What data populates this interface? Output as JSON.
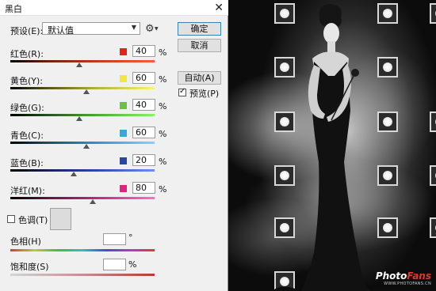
{
  "dialog": {
    "title": "黑白",
    "preset": {
      "label": "预设(E):",
      "value": "默认值"
    },
    "buttons": {
      "ok": "确定",
      "cancel": "取消",
      "auto": "自动(A)"
    },
    "preview": {
      "label": "预览(P)",
      "checked": true
    },
    "channels": [
      {
        "label": "红色(R):",
        "value": "40",
        "unit": "%",
        "color": "#e8211b",
        "slider_percent": 48
      },
      {
        "label": "黄色(Y):",
        "value": "60",
        "unit": "%",
        "color": "#f3e73a",
        "slider_percent": 53
      },
      {
        "label": "绿色(G):",
        "value": "40",
        "unit": "%",
        "color": "#6cc04a",
        "slider_percent": 48
      },
      {
        "label": "青色(C):",
        "value": "60",
        "unit": "%",
        "color": "#3ea6de",
        "slider_percent": 53
      },
      {
        "label": "蓝色(B):",
        "value": "20",
        "unit": "%",
        "color": "#2747a5",
        "slider_percent": 44
      },
      {
        "label": "洋红(M):",
        "value": "80",
        "unit": "%",
        "color": "#d8287c",
        "slider_percent": 57
      }
    ],
    "tint": {
      "label": "色调(T)",
      "checked": false
    },
    "hue": {
      "label": "色相(H)",
      "unit": "°"
    },
    "saturation": {
      "label": "饱和度(S)",
      "unit": "%"
    }
  },
  "photo": {
    "watermark_main_a": "Photo",
    "watermark_main_b": "Fans",
    "watermark_sub": "WWW.PHOTOFANS.CN"
  }
}
